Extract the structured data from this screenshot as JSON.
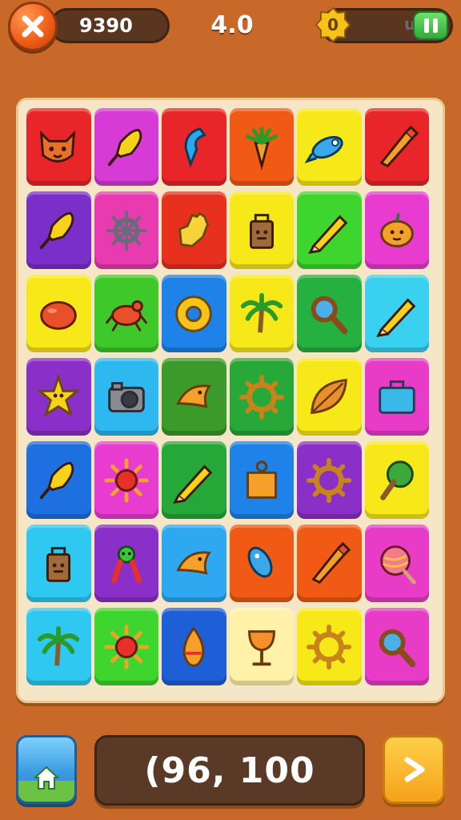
{
  "header": {
    "score": "9390",
    "level": "4.0",
    "coins": "0",
    "coin_suffix": "u"
  },
  "footer": {
    "counter": "(96, 100"
  },
  "colors": {
    "background": "#c8692a",
    "board": "#f5e6c8"
  },
  "tiles": [
    {
      "color": "#e8262a",
      "icon": "fox-face-icon"
    },
    {
      "color": "#d63bd6",
      "icon": "rocket-icon"
    },
    {
      "color": "#e8262a",
      "icon": "claw-icon"
    },
    {
      "color": "#f05a14",
      "icon": "carrot-icon"
    },
    {
      "color": "#f7e81a",
      "icon": "blue-fish-icon"
    },
    {
      "color": "#e8262a",
      "icon": "crayon-icon"
    },
    {
      "color": "#7a2fc8",
      "icon": "rocket-icon"
    },
    {
      "color": "#e83bb0",
      "icon": "ship-wheel-icon"
    },
    {
      "color": "#e8301e",
      "icon": "glove-icon"
    },
    {
      "color": "#f7e81a",
      "icon": "lantern-icon"
    },
    {
      "color": "#3ed62e",
      "icon": "pencil-icon"
    },
    {
      "color": "#e83bd0",
      "icon": "pumpkin-icon"
    },
    {
      "color": "#f7e81a",
      "icon": "lemon-icon"
    },
    {
      "color": "#3ec82a",
      "icon": "crab-icon"
    },
    {
      "color": "#1e82e8",
      "icon": "donut-icon"
    },
    {
      "color": "#f7e81a",
      "icon": "palm-tree-icon"
    },
    {
      "color": "#26b040",
      "icon": "magnifier-icon"
    },
    {
      "color": "#3ad0f0",
      "icon": "pencil-icon"
    },
    {
      "color": "#8a2fc8",
      "icon": "star-creature-icon"
    },
    {
      "color": "#2eb8f0",
      "icon": "camera-icon"
    },
    {
      "color": "#3a9a2a",
      "icon": "bird-icon"
    },
    {
      "color": "#28a838",
      "icon": "gear-icon"
    },
    {
      "color": "#f7e81a",
      "icon": "leaf-icon"
    },
    {
      "color": "#e83bc8",
      "icon": "suitcase-icon"
    },
    {
      "color": "#1e6fe0",
      "icon": "rocket-icon"
    },
    {
      "color": "#e83bd0",
      "icon": "sun-icon"
    },
    {
      "color": "#26a838",
      "icon": "pencil-icon"
    },
    {
      "color": "#1e82e8",
      "icon": "box-icon"
    },
    {
      "color": "#8a2fc8",
      "icon": "gear-icon"
    },
    {
      "color": "#f7e81a",
      "icon": "tree-icon"
    },
    {
      "color": "#2ec8f0",
      "icon": "lantern-icon"
    },
    {
      "color": "#8a2fc8",
      "icon": "alien-icon"
    },
    {
      "color": "#2ea8f0",
      "icon": "bird-icon"
    },
    {
      "color": "#f05a14",
      "icon": "fish-icon"
    },
    {
      "color": "#f05a14",
      "icon": "crayon-icon"
    },
    {
      "color": "#e83bc8",
      "icon": "lollipop-icon"
    },
    {
      "color": "#2ec8f0",
      "icon": "palm-tree-icon"
    },
    {
      "color": "#3ed62e",
      "icon": "sun-icon"
    },
    {
      "color": "#1e5fd8",
      "icon": "flame-icon"
    },
    {
      "color": "#fff2a8",
      "icon": "goblet-icon"
    },
    {
      "color": "#f7e81a",
      "icon": "gear-icon"
    },
    {
      "color": "#e83bc8",
      "icon": "magnifier-icon"
    }
  ]
}
